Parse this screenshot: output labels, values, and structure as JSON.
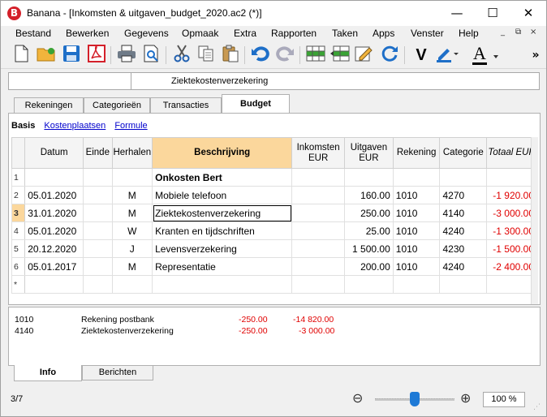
{
  "window": {
    "app_icon_letter": "B",
    "title": "Banana - [Inkomsten & uitgaven_budget_2020.ac2 (*)]",
    "minimize": "—",
    "maximize": "☐",
    "close": "✕"
  },
  "menu": {
    "items": [
      "Bestand",
      "Bewerken",
      "Gegevens",
      "Opmaak",
      "Extra",
      "Rapporten",
      "Taken",
      "Apps",
      "Venster",
      "Help"
    ],
    "mdi_controls": [
      "_",
      "⧉",
      "×"
    ]
  },
  "toolbar": {
    "icons": [
      "new-file-icon",
      "open-folder-icon",
      "save-icon",
      "pdf-icon",
      "print-icon",
      "print-preview-icon",
      "cut-icon",
      "copy-icon",
      "paste-icon",
      "undo-icon",
      "redo-icon",
      "add-row-icon",
      "insert-row-icon",
      "edit-icon",
      "recheck-icon",
      "bold-icon",
      "highlight-icon",
      "font-color-icon",
      "more-icon"
    ],
    "bold_label": "V",
    "font_color_label": "A",
    "more_label": "»"
  },
  "cellbar": {
    "address": "",
    "content": "Ziektekostenverzekering"
  },
  "tabs": [
    "Rekeningen",
    "Categorieën",
    "Transacties",
    "Budget"
  ],
  "active_tab": "Budget",
  "views": {
    "basis": "Basis",
    "kostenplaatsen": "Kostenplaatsen",
    "formule": "Formule"
  },
  "table": {
    "columns": [
      {
        "l1": "Datum",
        "l2": ""
      },
      {
        "l1": "Einde",
        "l2": ""
      },
      {
        "l1": "Herhalen",
        "l2": ""
      },
      {
        "l1": "Beschrijving",
        "l2": ""
      },
      {
        "l1": "Inkomsten",
        "l2": "EUR"
      },
      {
        "l1": "Uitgaven",
        "l2": "EUR"
      },
      {
        "l1": "Rekening",
        "l2": ""
      },
      {
        "l1": "Categorie",
        "l2": ""
      },
      {
        "l1": "Totaal EUR",
        "l2": ""
      }
    ],
    "rows": [
      {
        "n": "1",
        "datum": "",
        "einde": "",
        "herhalen": "",
        "beschrijving": "Onkosten Bert",
        "inkomsten": "",
        "uitgaven": "",
        "rekening": "",
        "categorie": "",
        "totaal": ""
      },
      {
        "n": "2",
        "datum": "05.01.2020",
        "einde": "",
        "herhalen": "M",
        "beschrijving": "Mobiele telefoon",
        "inkomsten": "",
        "uitgaven": "160.00",
        "rekening": "1010",
        "categorie": "4270",
        "totaal": "-1 920.00"
      },
      {
        "n": "3",
        "datum": "31.01.2020",
        "einde": "",
        "herhalen": "M",
        "beschrijving": "Ziektekostenverzekering",
        "inkomsten": "",
        "uitgaven": "250.00",
        "rekening": "1010",
        "categorie": "4140",
        "totaal": "-3 000.00"
      },
      {
        "n": "4",
        "datum": "05.01.2020",
        "einde": "",
        "herhalen": "W",
        "beschrijving": "Kranten en tijdschriften",
        "inkomsten": "",
        "uitgaven": "25.00",
        "rekening": "1010",
        "categorie": "4240",
        "totaal": "-1 300.00"
      },
      {
        "n": "5",
        "datum": "20.12.2020",
        "einde": "",
        "herhalen": "J",
        "beschrijving": "Levensverzekering",
        "inkomsten": "",
        "uitgaven": "1 500.00",
        "rekening": "1010",
        "categorie": "4230",
        "totaal": "-1 500.00"
      },
      {
        "n": "6",
        "datum": "05.01.2017",
        "einde": "",
        "herhalen": "M",
        "beschrijving": "Representatie",
        "inkomsten": "",
        "uitgaven": "200.00",
        "rekening": "1010",
        "categorie": "4240",
        "totaal": "-2 400.00"
      },
      {
        "n": "*",
        "datum": "",
        "einde": "",
        "herhalen": "",
        "beschrijving": "",
        "inkomsten": "",
        "uitgaven": "",
        "rekening": "",
        "categorie": "",
        "totaal": ""
      }
    ]
  },
  "info": {
    "rows": [
      {
        "code": "1010",
        "name": "Rekening postbank",
        "amount": "-250.00",
        "balance": "-14 820.00"
      },
      {
        "code": "4140",
        "name": "Ziektekostenverzekering",
        "amount": "-250.00",
        "balance": "-3 000.00"
      }
    ]
  },
  "bottom_tabs": [
    "Info",
    "Berichten"
  ],
  "status": {
    "position": "3/7",
    "zoom_out": "⊖",
    "zoom_in": "⊕",
    "zoom": "100 %",
    "zoom_level_percent": 100
  },
  "colors": {
    "accent_header": "#fbd79c",
    "negative": "#e00000",
    "link": "#0000cc",
    "slider": "#1e7ad6",
    "logo": "#d4202a"
  }
}
